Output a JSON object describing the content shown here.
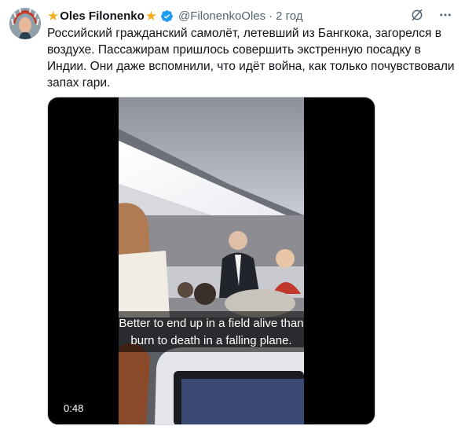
{
  "post": {
    "author_name": "Oles Filonenko",
    "handle": "@FilonenkoOles",
    "separator": "·",
    "time": "2 год",
    "text": "Российский гражданский самолёт, летевший из Бангкока, загорелся в воздухе. Пассажирам пришлось совершить экстренную посадку в Индии. Они даже вспомнили, что идёт война, как только почувствовали запах гари."
  },
  "video": {
    "caption_line1": "Better to end up in a field alive than",
    "caption_line2": "burn to death in a falling plane.",
    "duration": "0:48"
  },
  "icons": {
    "star": "star-emoji",
    "verified": "verified-badge-icon",
    "grok": "grok-icon",
    "more": "more-icon"
  },
  "colors": {
    "verified": "#1d9bf0",
    "star": "#f2b01e",
    "secondary_text": "#536471"
  }
}
